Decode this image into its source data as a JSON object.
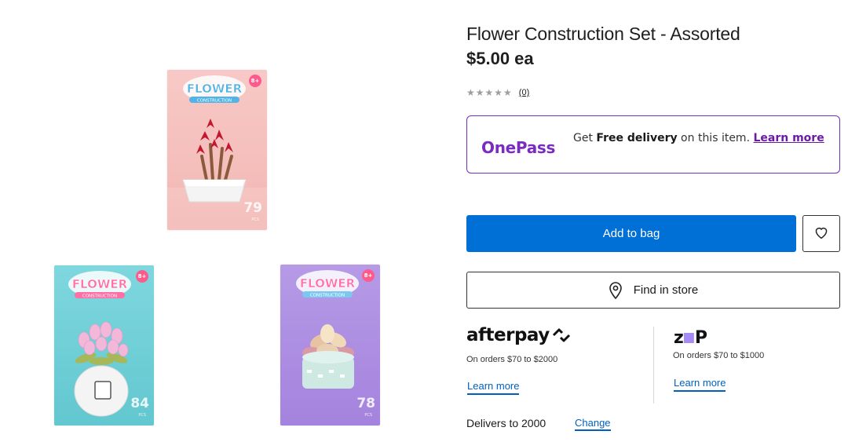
{
  "product": {
    "title": "Flower Construction Set - Assorted",
    "price": "$5.00 ea",
    "rating_stars": "★★★★★",
    "rating_count": "(0)"
  },
  "images": [
    {
      "name": "box-pink",
      "brand": "FLOWER",
      "sub": "CONSTRUCTION",
      "age": "8+",
      "count": "79",
      "pcs": "PCS"
    },
    {
      "name": "box-blue",
      "brand": "FLOWER",
      "sub": "CONSTRUCTION",
      "age": "8+",
      "count": "84",
      "pcs": "PCS"
    },
    {
      "name": "box-purple",
      "brand": "FLOWER",
      "sub": "CONSTRUCTION",
      "age": "8+",
      "count": "78",
      "pcs": "PCS"
    }
  ],
  "onepass": {
    "logo": "OnePass",
    "text_before": "Get ",
    "text_bold": "Free delivery",
    "text_after": " on this item. ",
    "link": "Learn more"
  },
  "actions": {
    "add_to_bag": "Add to bag",
    "find_in_store": "Find in store",
    "wishlist_icon": "heart-icon"
  },
  "afterpay": {
    "logo": "afterpay",
    "note": "On orders $70 to $2000",
    "link": "Learn more"
  },
  "zip": {
    "logo_left": "z",
    "logo_right": "P",
    "note": "On orders $70 to $1000",
    "link": "Learn more"
  },
  "delivery": {
    "text": "Delivers to 2000",
    "change": "Change"
  },
  "colors": {
    "primary_blue": "#0070d6",
    "onepass_purple": "#7a2bc2",
    "zip_purple": "#a68bf5",
    "link_blue": "#0060c0"
  }
}
